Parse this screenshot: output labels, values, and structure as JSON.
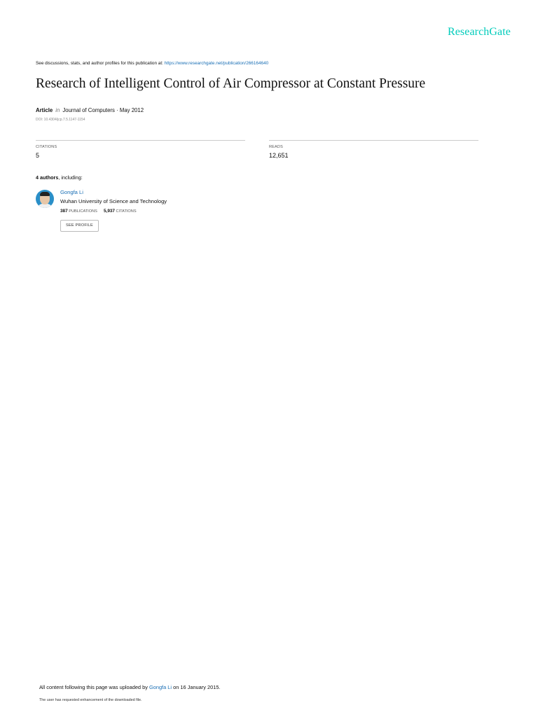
{
  "header": {
    "logo": "ResearchGate",
    "discuss_prefix": "See discussions, stats, and author profiles for this publication at:",
    "discuss_link": "https://www.researchgate.net/publication/266164640"
  },
  "publication": {
    "title": "Research of Intelligent Control of Air Compressor at Constant Pressure",
    "type": "Article",
    "in_label": "in",
    "venue_date": "Journal of Computers · May 2012",
    "doi": "DOI: 10.4304/jcp.7.5.1147-1154"
  },
  "stats": {
    "citations_label": "CITATIONS",
    "citations_value": "5",
    "reads_label": "READS",
    "reads_value": "12,651"
  },
  "authors": {
    "heading_bold": "4 authors",
    "heading_rest": ", including:",
    "list": [
      {
        "name": "Gongfa Li",
        "institution": "Wuhan University of Science and Technology",
        "publications_count": "387",
        "publications_label": "PUBLICATIONS",
        "citations_count": "5,937",
        "citations_label": "CITATIONS",
        "button_label": "SEE PROFILE"
      }
    ]
  },
  "footer": {
    "uploaded_prefix": "All content following this page was uploaded by",
    "uploaded_by": "Gongfa Li",
    "uploaded_suffix": "on 16 January 2015.",
    "enhancement_note": "The user has requested enhancement of the downloaded file."
  },
  "colors": {
    "brand": "#00ccbb",
    "link": "#1a6fb5",
    "divider": "#cccccc"
  }
}
